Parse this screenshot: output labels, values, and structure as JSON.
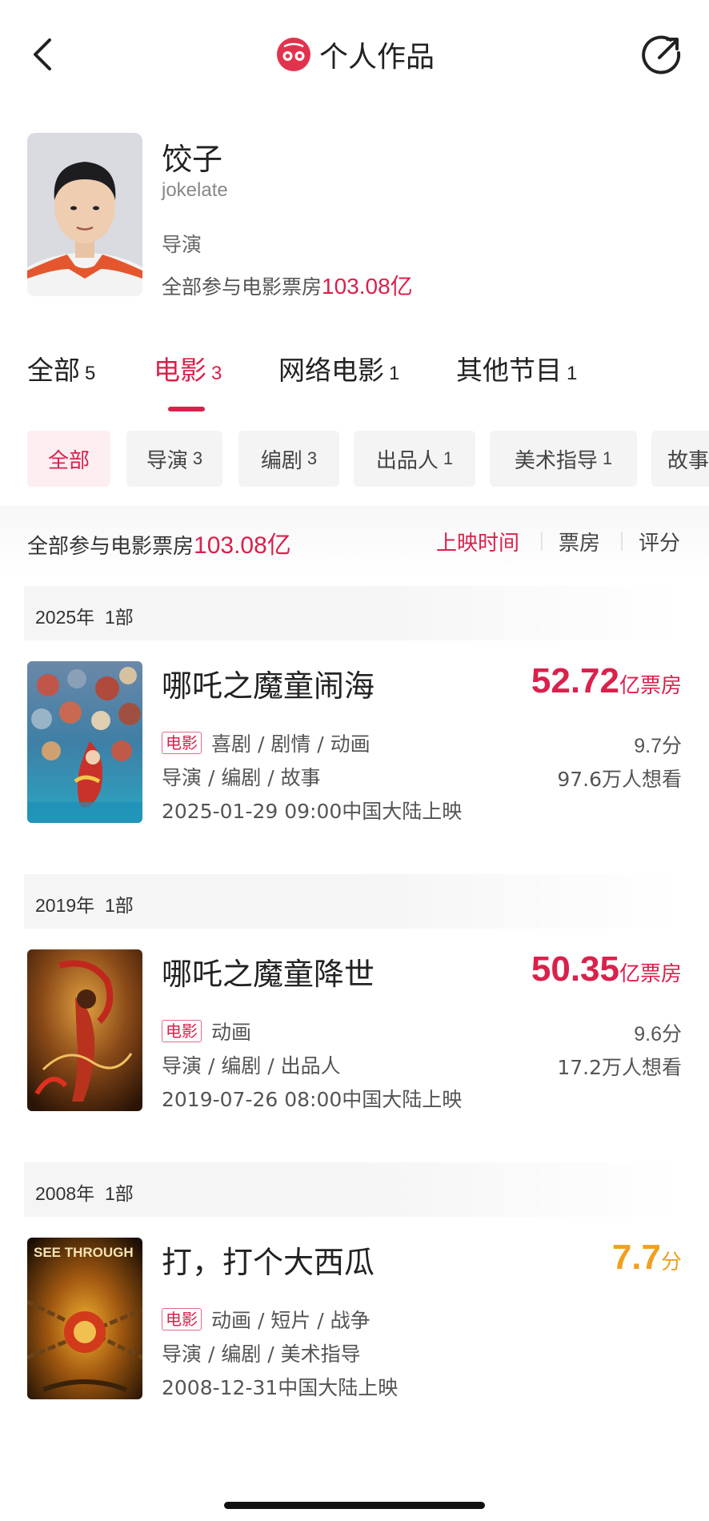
{
  "header": {
    "title": "个人作品",
    "back_icon": "chevron-left-icon",
    "share_icon": "share-icon",
    "logo_icon": "maoyan-cat-logo-icon"
  },
  "profile": {
    "name": "饺子",
    "username": "jokelate",
    "role": "导演",
    "boxoffice_label": "全部参与电影票房",
    "boxoffice_value": "103.08亿"
  },
  "tabs": [
    {
      "label": "全部",
      "count": "5"
    },
    {
      "label": "电影",
      "count": "3"
    },
    {
      "label": "网络电影",
      "count": "1"
    },
    {
      "label": "其他节目",
      "count": "1"
    }
  ],
  "chips": [
    {
      "label": "全部",
      "count": ""
    },
    {
      "label": "导演",
      "count": "3"
    },
    {
      "label": "编剧",
      "count": "3"
    },
    {
      "label": "出品人",
      "count": "1"
    },
    {
      "label": "美术指导",
      "count": "1"
    },
    {
      "label": "故事",
      "count": ""
    }
  ],
  "summary": {
    "label": "全部参与电影票房",
    "value": "103.08亿",
    "sort_options": [
      "上映时间",
      "票房",
      "评分"
    ]
  },
  "years": [
    {
      "year": "2025年",
      "count": "1部"
    },
    {
      "year": "2019年",
      "count": "1部"
    },
    {
      "year": "2008年",
      "count": "1部"
    }
  ],
  "films": [
    {
      "title": "哪吒之魔童闹海",
      "badge": "电影",
      "genres": "喜剧 / 剧情 / 动画",
      "roles": "导演 / 编剧 / 故事",
      "date": "2025-01-29 09:00中国大陆上映",
      "boxoffice": "52.72",
      "boxoffice_unit": "亿票房",
      "score": "9.7分",
      "want": "97.6万人想看"
    },
    {
      "title": "哪吒之魔童降世",
      "badge": "电影",
      "genres": "动画",
      "roles": "导演 / 编剧 / 出品人",
      "date": "2019-07-26 08:00中国大陆上映",
      "boxoffice": "50.35",
      "boxoffice_unit": "亿票房",
      "score": "9.6分",
      "want": "17.2万人想看"
    },
    {
      "title": "打，打个大西瓜",
      "badge": "电影",
      "genres": "动画 / 短片 / 战争",
      "roles": "导演 / 编剧 / 美术指导",
      "date": "2008-12-31中国大陆上映",
      "score_big": "7.7",
      "score_unit": "分",
      "poster_text": "SEE THROUGH"
    }
  ],
  "colors": {
    "accent": "#d9214c",
    "score_orange": "#f0a020"
  }
}
